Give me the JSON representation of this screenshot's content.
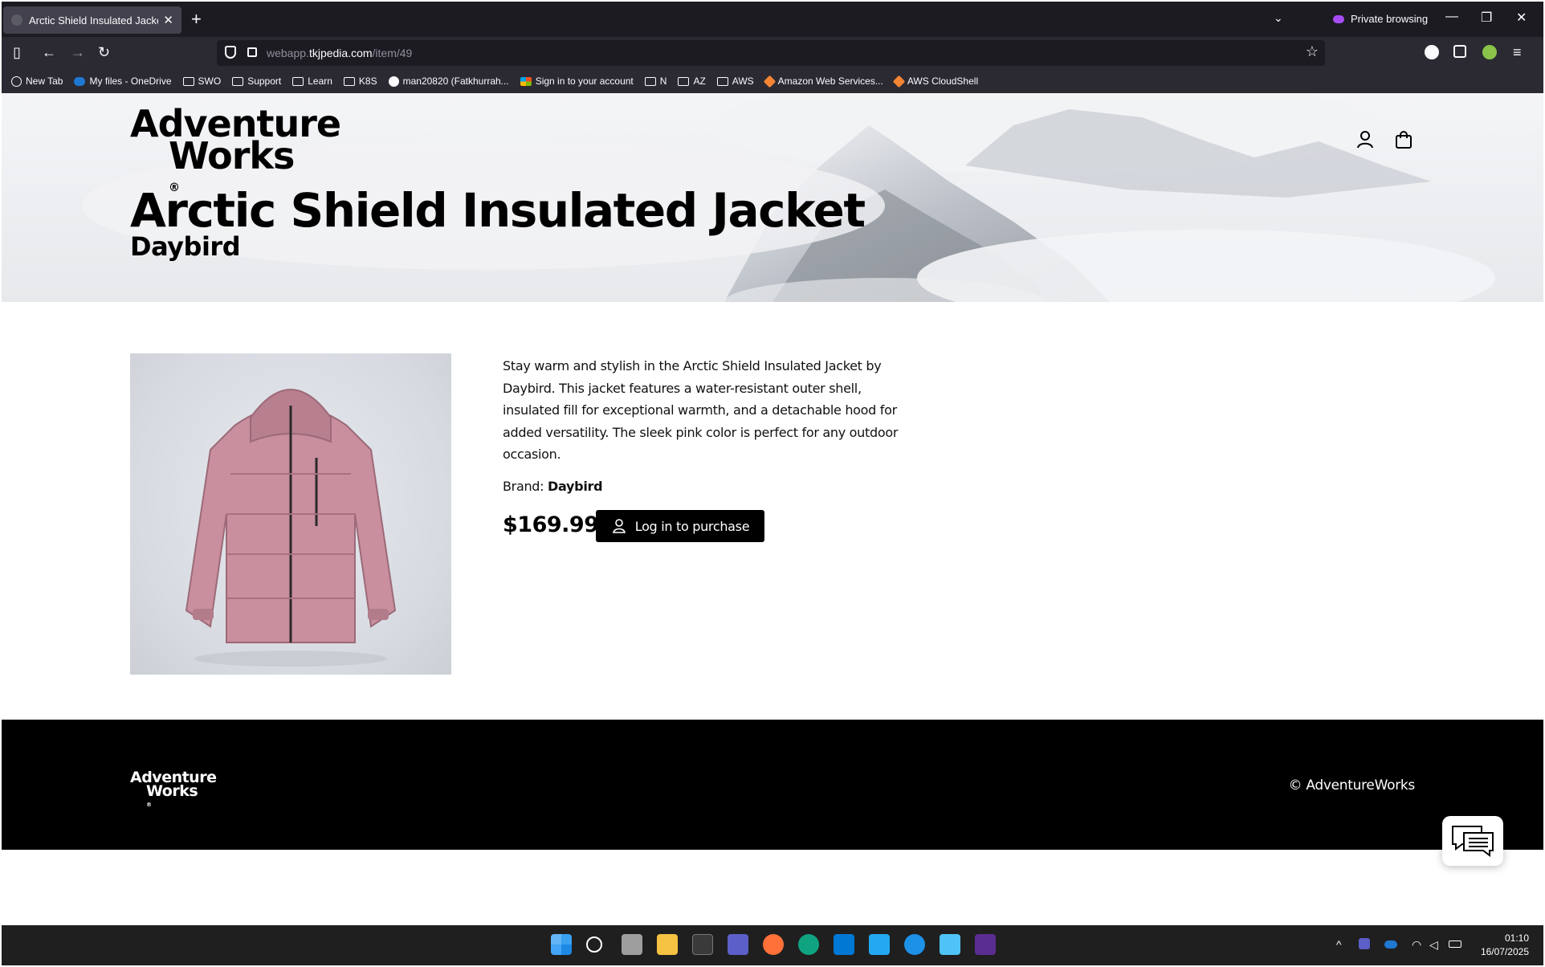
{
  "browser": {
    "tab_title": "Arctic Shield Insulated Jacket | A",
    "new_tab": "+",
    "list_tabs": "⌄",
    "private_label": "Private browsing",
    "minimize": "—",
    "restore": "❐",
    "close": "✕",
    "url_host_prefix": "webapp.",
    "url_host_domain": "tkjpedia.com",
    "url_path": "/item/49",
    "bookmarks": [
      {
        "label": "New Tab",
        "icon": "globe-icon"
      },
      {
        "label": "My files - OneDrive",
        "icon": "onedrive-icon"
      },
      {
        "label": "SWO",
        "icon": "folder-icon"
      },
      {
        "label": "Support",
        "icon": "folder-icon"
      },
      {
        "label": "Learn",
        "icon": "folder-icon"
      },
      {
        "label": "K8S",
        "icon": "folder-icon"
      },
      {
        "label": "man20820 (Fatkhurrah...",
        "icon": "github-icon"
      },
      {
        "label": "Sign in to your account",
        "icon": "microsoft-icon"
      },
      {
        "label": "N",
        "icon": "folder-icon"
      },
      {
        "label": "AZ",
        "icon": "folder-icon"
      },
      {
        "label": "AWS",
        "icon": "folder-icon"
      },
      {
        "label": "Amazon Web Services...",
        "icon": "aws-icon"
      },
      {
        "label": "AWS CloudShell",
        "icon": "aws-icon"
      }
    ]
  },
  "site": {
    "logo_line1": "Adventure",
    "logo_line2": "Works",
    "logo_mark": "®"
  },
  "product": {
    "name": "Arctic Shield Insulated Jacket",
    "brand": "Daybird",
    "description": "Stay warm and stylish in the Arctic Shield Insulated Jacket by Daybird. This jacket features a water-resistant outer shell, insulated fill for exceptional warmth, and a detachable hood for added versatility. The sleek pink color is perfect for any outdoor occasion.",
    "brand_label": "Brand:",
    "price": "$169.99",
    "buy_label": "Log in to purchase",
    "jacket_color": "#c98f9e"
  },
  "footer": {
    "logo_line1": "Adventure",
    "logo_line2": "Works",
    "copyright": "© AdventureWorks"
  },
  "taskbar": {
    "time": "01:10",
    "date": "16/07/2025"
  }
}
